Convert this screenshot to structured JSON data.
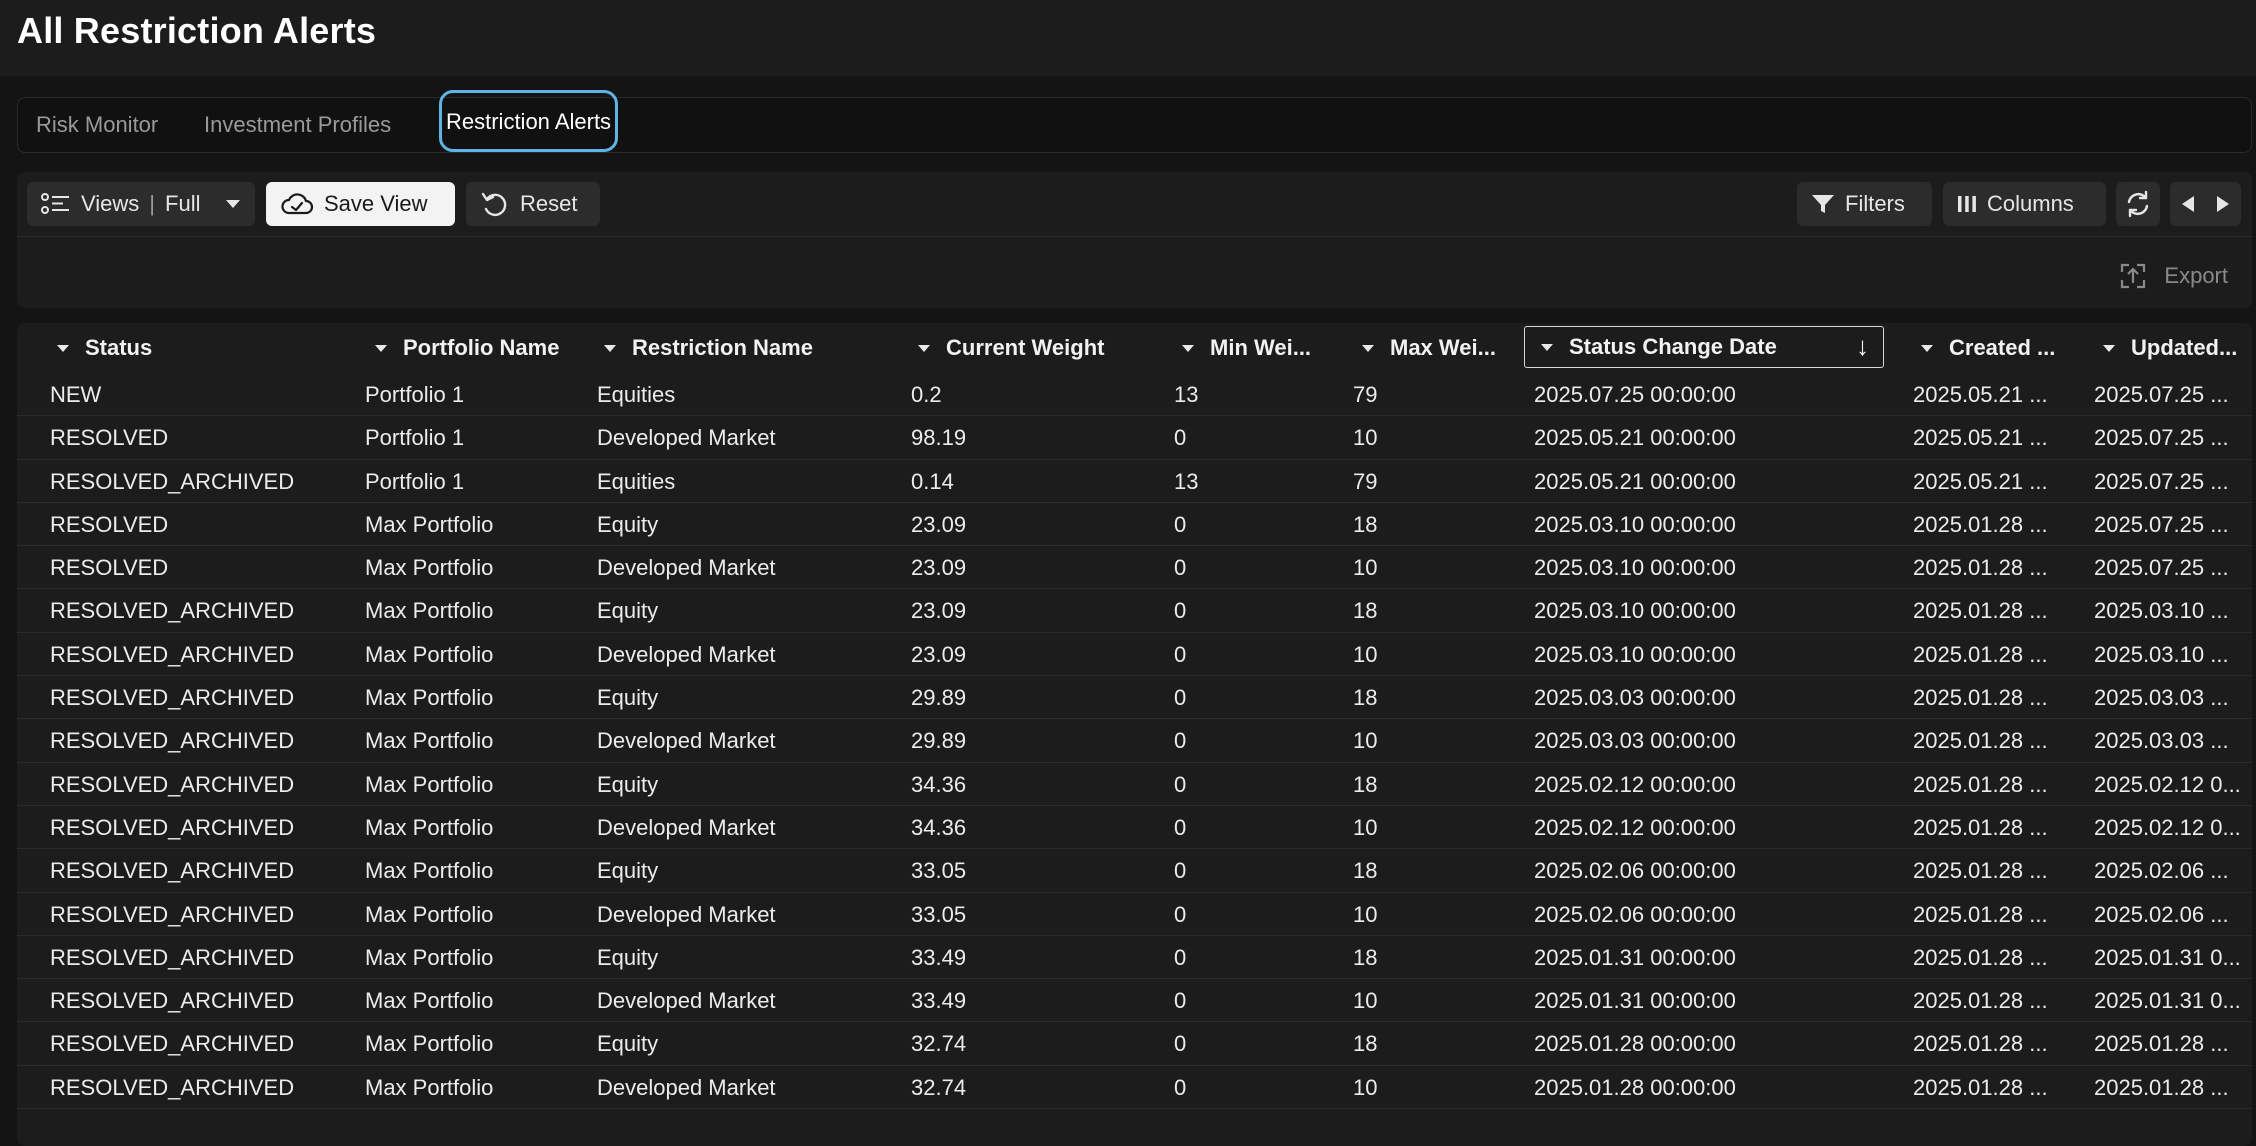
{
  "page": {
    "title": "All Restriction Alerts"
  },
  "tabs": [
    {
      "label": "Risk Monitor",
      "active": false
    },
    {
      "label": "Investment Profiles",
      "active": false
    },
    {
      "label": "Restriction Alerts",
      "active": true
    }
  ],
  "toolbar": {
    "views_label": "Views",
    "views_separator": "|",
    "views_value": "Full",
    "save_view_label": "Save View",
    "reset_label": "Reset",
    "filters_label": "Filters",
    "columns_label": "Columns",
    "export_label": "Export"
  },
  "icons": {
    "views": "list-icon",
    "save_view": "cloud-icon",
    "reset": "reset-icon",
    "filters": "filter-icon",
    "columns": "columns-icon",
    "refresh": "refresh-icon",
    "export": "export-icon"
  },
  "colors": {
    "accent": "#5fb4e3",
    "background": "#141414",
    "panel": "#1c1c1c"
  },
  "grid": {
    "sorted_column": "Status Change Date",
    "sort_direction": "descending",
    "columns": [
      "Status",
      "Portfolio Name",
      "Restriction Name",
      "Current Weight",
      "Min Wei...",
      "Max Wei...",
      "Status Change Date",
      "Created ...",
      "Updated..."
    ],
    "rows": [
      [
        "NEW",
        "Portfolio 1",
        "Equities",
        "0.2",
        "13",
        "79",
        "2025.07.25 00:00:00",
        "2025.05.21 ...",
        "2025.07.25 ..."
      ],
      [
        "RESOLVED",
        "Portfolio 1",
        "Developed Market",
        "98.19",
        "0",
        "10",
        "2025.05.21 00:00:00",
        "2025.05.21 ...",
        "2025.07.25 ..."
      ],
      [
        "RESOLVED_ARCHIVED",
        "Portfolio 1",
        "Equities",
        "0.14",
        "13",
        "79",
        "2025.05.21 00:00:00",
        "2025.05.21 ...",
        "2025.07.25 ..."
      ],
      [
        "RESOLVED",
        "Max Portfolio",
        "Equity",
        "23.09",
        "0",
        "18",
        "2025.03.10 00:00:00",
        "2025.01.28 ...",
        "2025.07.25 ..."
      ],
      [
        "RESOLVED",
        "Max Portfolio",
        "Developed Market",
        "23.09",
        "0",
        "10",
        "2025.03.10 00:00:00",
        "2025.01.28 ...",
        "2025.07.25 ..."
      ],
      [
        "RESOLVED_ARCHIVED",
        "Max Portfolio",
        "Equity",
        "23.09",
        "0",
        "18",
        "2025.03.10 00:00:00",
        "2025.01.28 ...",
        "2025.03.10 ..."
      ],
      [
        "RESOLVED_ARCHIVED",
        "Max Portfolio",
        "Developed Market",
        "23.09",
        "0",
        "10",
        "2025.03.10 00:00:00",
        "2025.01.28 ...",
        "2025.03.10 ..."
      ],
      [
        "RESOLVED_ARCHIVED",
        "Max Portfolio",
        "Equity",
        "29.89",
        "0",
        "18",
        "2025.03.03 00:00:00",
        "2025.01.28 ...",
        "2025.03.03 ..."
      ],
      [
        "RESOLVED_ARCHIVED",
        "Max Portfolio",
        "Developed Market",
        "29.89",
        "0",
        "10",
        "2025.03.03 00:00:00",
        "2025.01.28 ...",
        "2025.03.03 ..."
      ],
      [
        "RESOLVED_ARCHIVED",
        "Max Portfolio",
        "Equity",
        "34.36",
        "0",
        "18",
        "2025.02.12 00:00:00",
        "2025.01.28 ...",
        "2025.02.12 0..."
      ],
      [
        "RESOLVED_ARCHIVED",
        "Max Portfolio",
        "Developed Market",
        "34.36",
        "0",
        "10",
        "2025.02.12 00:00:00",
        "2025.01.28 ...",
        "2025.02.12 0..."
      ],
      [
        "RESOLVED_ARCHIVED",
        "Max Portfolio",
        "Equity",
        "33.05",
        "0",
        "18",
        "2025.02.06 00:00:00",
        "2025.01.28 ...",
        "2025.02.06 ..."
      ],
      [
        "RESOLVED_ARCHIVED",
        "Max Portfolio",
        "Developed Market",
        "33.05",
        "0",
        "10",
        "2025.02.06 00:00:00",
        "2025.01.28 ...",
        "2025.02.06 ..."
      ],
      [
        "RESOLVED_ARCHIVED",
        "Max Portfolio",
        "Equity",
        "33.49",
        "0",
        "18",
        "2025.01.31 00:00:00",
        "2025.01.28 ...",
        "2025.01.31 0..."
      ],
      [
        "RESOLVED_ARCHIVED",
        "Max Portfolio",
        "Developed Market",
        "33.49",
        "0",
        "10",
        "2025.01.31 00:00:00",
        "2025.01.28 ...",
        "2025.01.31 0..."
      ],
      [
        "RESOLVED_ARCHIVED",
        "Max Portfolio",
        "Equity",
        "32.74",
        "0",
        "18",
        "2025.01.28 00:00:00",
        "2025.01.28 ...",
        "2025.01.28 ..."
      ],
      [
        "RESOLVED_ARCHIVED",
        "Max Portfolio",
        "Developed Market",
        "32.74",
        "0",
        "10",
        "2025.01.28 00:00:00",
        "2025.01.28 ...",
        "2025.01.28 ..."
      ]
    ]
  }
}
